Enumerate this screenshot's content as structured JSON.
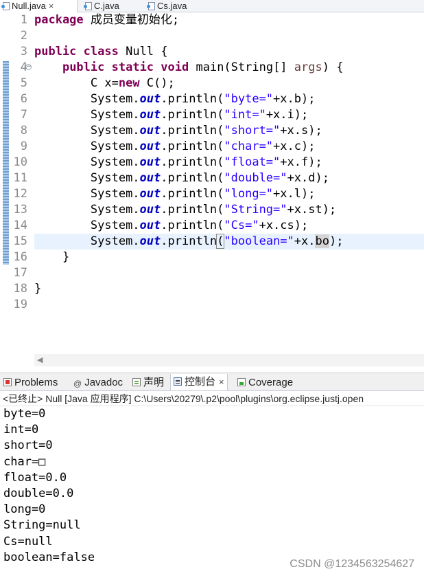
{
  "editor_tabs": [
    {
      "label": "Null.java",
      "active": true,
      "closable": true
    },
    {
      "label": "C.java",
      "active": false
    },
    {
      "label": "Cs.java",
      "active": false
    }
  ],
  "code": {
    "line_numbers": [
      "1",
      "2",
      "3",
      "4",
      "5",
      "6",
      "7",
      "8",
      "9",
      "10",
      "11",
      "12",
      "13",
      "14",
      "15",
      "16",
      "17",
      "18",
      "19"
    ],
    "line1": {
      "kw": "package",
      "text": " 成员变量初始化;"
    },
    "line3": {
      "kw1": "public",
      "kw2": "class",
      "text": " Null {"
    },
    "line4": {
      "kw1": "public",
      "kw2": "static",
      "kw3": "void",
      "text1": " main(String[] ",
      "param": "args",
      "text2": ") {"
    },
    "line5": {
      "text1": "C x=",
      "kw": "new",
      "text2": " C();"
    },
    "println_prefix": "System.",
    "println_field": "out",
    "println_method": ".println(",
    "println_lines": [
      {
        "str": "\"byte=\"",
        "expr": "+x.b);"
      },
      {
        "str": "\"int=\"",
        "expr": "+x.i);"
      },
      {
        "str": "\"short=\"",
        "expr": "+x.s);"
      },
      {
        "str": "\"char=\"",
        "expr": "+x.c);"
      },
      {
        "str": "\"float=\"",
        "expr": "+x.f);"
      },
      {
        "str": "\"double=\"",
        "expr": "+x.d);"
      },
      {
        "str": "\"long=\"",
        "expr": "+x.l);"
      },
      {
        "str": "\"String=\"",
        "expr": "+x.st);"
      },
      {
        "str": "\"Cs=\"",
        "expr": "+x.cs);"
      }
    ],
    "line15": {
      "method": ".println",
      "paren": "(",
      "str": "\"boolean=\"",
      "expr1": "+x.",
      "highlight": "bo",
      "expr2": ");"
    },
    "line16": "}",
    "line18": "}"
  },
  "view_tabs": [
    {
      "label": "Problems",
      "icon": "problems-icon"
    },
    {
      "label": "Javadoc",
      "icon": "javadoc-icon"
    },
    {
      "label": "声明",
      "icon": "declaration-icon"
    },
    {
      "label": "控制台",
      "icon": "console-icon",
      "active": true
    },
    {
      "label": "Coverage",
      "icon": "coverage-icon"
    }
  ],
  "console": {
    "header": "<已终止> Null [Java 应用程序] C:\\Users\\20279\\.p2\\pool\\plugins\\org.eclipse.justj.open",
    "output": [
      "byte=0",
      "int=0",
      "short=0",
      "char=□",
      "float=0.0",
      "double=0.0",
      "long=0",
      "String=null",
      "Cs=null",
      "boolean=false"
    ]
  },
  "watermark": "CSDN @1234563254627",
  "colors": {
    "keyword": "#7f0055",
    "field": "#0000c0",
    "string": "#2a00ff",
    "parameter": "#6a3e3e",
    "current_line": "#e8f2fe"
  }
}
